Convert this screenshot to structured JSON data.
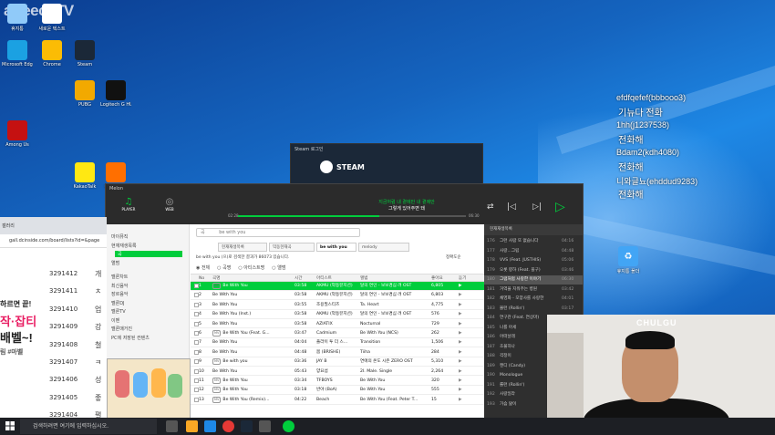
{
  "overlay": {
    "brand_logo": "afreecaTV",
    "chat": [
      {
        "user": "efdfqefef(bbbooo3)",
        "message": "기뉴다 전화"
      },
      {
        "user": "1hh(j1237538)",
        "message": "전화해"
      },
      {
        "user": "Bdam2(kdh4080)",
        "message": "전화해"
      },
      {
        "user": "니와글뇨(ehddud9283)",
        "message": "전화해"
      }
    ],
    "webcam_sign": "CHULGU"
  },
  "desktop": {
    "icons": [
      {
        "label": "휴지통",
        "icon": "recycle-bin-icon",
        "color": "#90caf9"
      },
      {
        "label": "새로운 텍스트",
        "icon": "text-file-icon",
        "color": "#ffffff"
      },
      {
        "label": "Microsoft Edge",
        "icon": "edge-icon",
        "color": "#1ba1e2"
      },
      {
        "label": "Chrome",
        "icon": "chrome-icon",
        "color": "#fbbc05"
      },
      {
        "label": "Steam",
        "icon": "steam-icon",
        "color": "#1b2838"
      },
      {
        "label": "PUBG",
        "icon": "pubg-icon",
        "color": "#f2a900"
      },
      {
        "label": "Logitech G HUB",
        "icon": "ghub-icon",
        "color": "#111111"
      },
      {
        "label": "Among Us",
        "icon": "amongus-icon",
        "color": "#c51111"
      },
      {
        "label": "KakaoTalk",
        "icon": "kakao-icon",
        "color": "#ffe812"
      },
      {
        "label": "COUPANG",
        "icon": "coupang-icon",
        "color": "#ff6f00"
      }
    ],
    "recycle_right": "휴지통 폴더"
  },
  "steam_dialog": {
    "title": "Steam 로그인",
    "logo": "STEAM"
  },
  "melon": {
    "brand": "Melon",
    "nav": [
      {
        "label": "PLAYER",
        "icon": "music-note-icon"
      },
      {
        "label": "WEB",
        "icon": "globe-icon"
      }
    ],
    "now_playing": {
      "title": "지금처럼 내 곁에만 내 곁에만",
      "subtitle": "그렇게 있어주면 돼",
      "progress": 0.62,
      "elapsed": "02:28",
      "total": "06:30"
    },
    "sidebar": [
      {
        "label": "마이뮤직",
        "active": false
      },
      {
        "label": "현재재생목록",
        "active": false
      },
      {
        "label": "곡",
        "active": true
      },
      {
        "label": "앨범",
        "active": false
      },
      {
        "label": "멜론차트",
        "active": false
      },
      {
        "label": "최신음악",
        "active": false
      },
      {
        "label": "장르음악",
        "active": false
      },
      {
        "label": "멜론DJ",
        "active": false
      },
      {
        "label": "멜론TV",
        "active": false
      },
      {
        "label": "이벤",
        "active": false
      },
      {
        "label": "멜론매거진",
        "active": false
      },
      {
        "label": "PC에 저장된 컨텐츠",
        "active": false
      }
    ],
    "search": {
      "value": "be with you",
      "prefix": "곡"
    },
    "tabs": [
      {
        "label": "현재재생목록",
        "active": false
      },
      {
        "label": "믹동현재곡",
        "active": false
      },
      {
        "label": "be with you",
        "active": true
      },
      {
        "label": "melody",
        "active": false
      }
    ],
    "result_text": "be with you (으)로 검색한 결과가 86073 있습니다.",
    "sort_label": "정확도순",
    "filters": [
      "전체",
      "곡명",
      "아티스트명",
      "앨범"
    ],
    "columns": [
      "No",
      "곡명",
      "시간",
      "아티스트",
      "앨범",
      "좋아요",
      "듣기"
    ],
    "rows": [
      {
        "no": "1",
        "title": "Be With You",
        "mv": true,
        "time": "03:58",
        "artist": "AKMU (악동뮤지션)",
        "album": "달의 연인 - 보보경심 려 OST",
        "likes": "6,805",
        "sel": true
      },
      {
        "no": "2",
        "title": "Be With You",
        "mv": false,
        "time": "03:58",
        "artist": "AKMU (악동뮤지션)",
        "album": "달의 연인 - 보보경심 려 OST",
        "likes": "6,803",
        "sel": false
      },
      {
        "no": "3",
        "title": "Be With You",
        "mv": false,
        "time": "03:55",
        "artist": "조용필스티즈",
        "album": "Ta. Heart",
        "likes": "4,775",
        "sel": false
      },
      {
        "no": "4",
        "title": "Be With You (Inst.)",
        "mv": false,
        "time": "03:58",
        "artist": "AKMU (악동뮤지션)",
        "album": "달의 연인 - 보보경심 려 OST",
        "likes": "576",
        "sel": false
      },
      {
        "no": "5",
        "title": "Be With You",
        "mv": false,
        "time": "03:58",
        "artist": "AZIATIX",
        "album": "Nocturnal",
        "likes": "729",
        "sel": false
      },
      {
        "no": "6",
        "title": "Be With You (Feat. G...",
        "mv": true,
        "time": "03:47",
        "artist": "Cadmium",
        "album": "Be With You (NCS)",
        "likes": "262",
        "sel": false
      },
      {
        "no": "7",
        "title": "Be With You",
        "mv": false,
        "time": "04:04",
        "artist": "플라이 투 더 스...",
        "album": "Transition",
        "likes": "1,506",
        "sel": false
      },
      {
        "no": "8",
        "title": "Be With You",
        "mv": false,
        "time": "04:48",
        "artist": "봄 (BRISHE)",
        "album": "Tiiha",
        "likes": "284",
        "sel": false
      },
      {
        "no": "9",
        "title": "Be with you",
        "mv": true,
        "time": "03:36",
        "artist": "JAY B",
        "album": "연애의 온도 시즌 ZERO OST",
        "likes": "5,310",
        "sel": false
      },
      {
        "no": "10",
        "title": "Be With You",
        "mv": false,
        "time": "05:43",
        "artist": "양요섭",
        "album": "2I. Male. Single",
        "likes": "2,264",
        "sel": false
      },
      {
        "no": "11",
        "title": "Be With You",
        "mv": true,
        "time": "03:34",
        "artist": "TFBOYS",
        "album": "Be With You",
        "likes": "320",
        "sel": false
      },
      {
        "no": "12",
        "title": "Be With You",
        "mv": true,
        "time": "03:18",
        "artist": "반야 (BoA)",
        "album": "Be With You",
        "likes": "555",
        "sel": false
      },
      {
        "no": "13",
        "title": "Be With You (Remix)...",
        "mv": true,
        "time": "04:22",
        "artist": "Beach",
        "album": "Be With You (Feat. Peter T...",
        "likes": "15",
        "sel": false
      }
    ],
    "playlist": {
      "head": "현재재생목록",
      "items": [
        {
          "no": "176",
          "title": "그런 사람 또 없습니다",
          "time": "04:16",
          "sel": false
        },
        {
          "no": "177",
          "title": "사랑...그립",
          "time": "04:48",
          "sel": false
        },
        {
          "no": "178",
          "title": "VVS (Feat. JUSTHIS)",
          "time": "05:06",
          "sel": false
        },
        {
          "no": "179",
          "title": "오롯 향하 (Feat. 블구)",
          "time": "03:46",
          "sel": false
        },
        {
          "no": "180",
          "title": "그럼처럼 사랑한 이야기",
          "time": "06:30",
          "sel": true
        },
        {
          "no": "181",
          "title": "거역을 지워주는 병원",
          "time": "03:42",
          "sel": false
        },
        {
          "no": "182",
          "title": "채영화 - 모양사를 사랑한",
          "time": "04:01",
          "sel": false
        },
        {
          "no": "183",
          "title": "몰런 (Rollin')",
          "time": "03:17",
          "sel": false
        },
        {
          "no": "184",
          "title": "연구관 (Feat. 연상마)",
          "time": "04:10",
          "sel": false
        },
        {
          "no": "185",
          "title": "나를 아세",
          "time": "03:50",
          "sel": false
        },
        {
          "no": "186",
          "title": "어떠날래",
          "time": "03:25",
          "sel": false
        },
        {
          "no": "187",
          "title": "초불하나",
          "time": "03:38",
          "sel": false
        },
        {
          "no": "188",
          "title": "걱정이",
          "time": "03:55",
          "sel": false
        },
        {
          "no": "189",
          "title": "캔디 (Candy)",
          "time": "03:24",
          "sel": false
        },
        {
          "no": "190",
          "title": "Monologue",
          "time": "04:13",
          "sel": false
        },
        {
          "no": "191",
          "title": "롤런 (Rollin')",
          "time": "03:16",
          "sel": false
        },
        {
          "no": "192",
          "title": "사랑일라",
          "time": "04:01",
          "sel": false
        },
        {
          "no": "193",
          "title": "가슴 앓이",
          "time": "03:40",
          "sel": false
        }
      ]
    }
  },
  "browser": {
    "tab_title": "갤러리",
    "url": "gall.dcinside.com/board/lists?id=&page",
    "posts": [
      {
        "id": "3291412",
        "initial": "개"
      },
      {
        "id": "3291411",
        "initial": "ㅊ"
      },
      {
        "id": "3291410",
        "initial": "업"
      },
      {
        "id": "3291409",
        "initial": "강"
      },
      {
        "id": "3291408",
        "initial": "철"
      },
      {
        "id": "3291407",
        "initial": "ㅋ"
      },
      {
        "id": "3291406",
        "initial": "성"
      },
      {
        "id": "3291405",
        "initial": "좋"
      },
      {
        "id": "3291404",
        "initial": "펼"
      }
    ],
    "ad_lines": [
      {
        "text": "하르면 끝!",
        "color": "#222222"
      },
      {
        "text": "작·잡티",
        "color": "#e91e63"
      },
      {
        "text": "배벨~!",
        "color": "#222222"
      },
      {
        "text": "림 #마벨",
        "color": "#555555"
      }
    ]
  },
  "taskbar": {
    "search_placeholder": "검색하려면 여기에 입력하십시오."
  }
}
